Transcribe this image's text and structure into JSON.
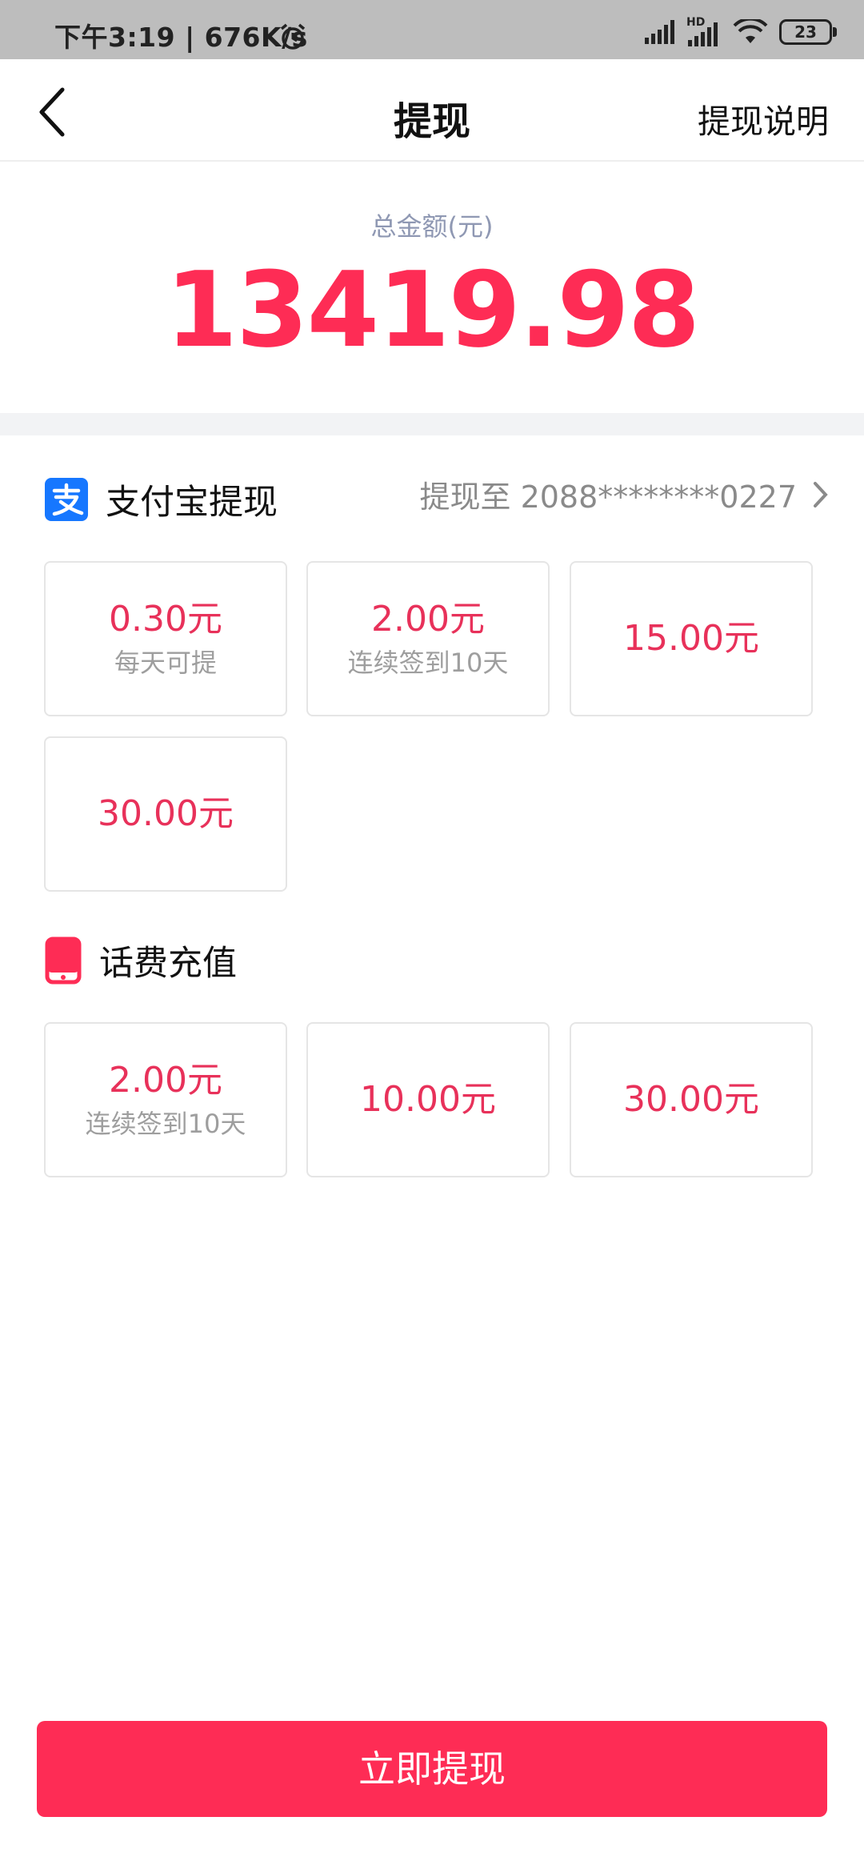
{
  "status_bar": {
    "time_speed": "下午3:19 | 676K/s",
    "battery": "23",
    "hd": "HD"
  },
  "nav": {
    "title": "提现",
    "right_link": "提现说明"
  },
  "balance": {
    "label": "总金额(元)",
    "amount": "13419.98"
  },
  "alipay": {
    "title": "支付宝提现",
    "account": "提现至 2088********0227",
    "options": [
      {
        "amount": "0.30元",
        "note": "每天可提"
      },
      {
        "amount": "2.00元",
        "note": "连续签到10天"
      },
      {
        "amount": "15.00元",
        "note": ""
      },
      {
        "amount": "30.00元",
        "note": ""
      }
    ]
  },
  "phone": {
    "title": "话费充值",
    "options": [
      {
        "amount": "2.00元",
        "note": "连续签到10天"
      },
      {
        "amount": "10.00元",
        "note": ""
      },
      {
        "amount": "30.00元",
        "note": ""
      }
    ]
  },
  "cta": {
    "label": "立即提现"
  },
  "colors": {
    "accent": "#fe2c55",
    "alipay_blue": "#1677ff"
  }
}
